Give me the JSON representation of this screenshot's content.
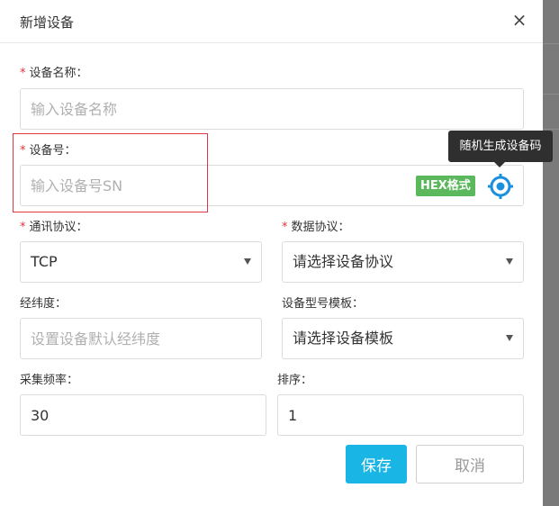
{
  "dialog": {
    "title": "新增设备",
    "close_symbol": "×"
  },
  "fields": {
    "device_name": {
      "required_mark": "*",
      "label": "设备名称：",
      "placeholder": "输入设备名称"
    },
    "device_sn": {
      "required_mark": "*",
      "label": "设备号：",
      "placeholder": "输入设备号SN",
      "badge": "HEX格式",
      "tooltip": "随机生成设备码",
      "icon": "locate-target-icon"
    },
    "comm_protocol": {
      "required_mark": "*",
      "label": "通讯协议：",
      "value": "TCP"
    },
    "data_protocol": {
      "required_mark": "*",
      "label": "数据协议：",
      "value": "请选择设备协议"
    },
    "coords": {
      "label": "经纬度：",
      "placeholder": "设置设备默认经纬度"
    },
    "model_template": {
      "label": "设备型号模板：",
      "value": "请选择设备模板"
    },
    "frequency": {
      "label": "采集频率：",
      "value": "30"
    },
    "sort": {
      "label": "排序：",
      "value": "1"
    }
  },
  "buttons": {
    "save": "保存",
    "cancel": "取消"
  },
  "colors": {
    "primary": "#18b5e5",
    "required": "#e5323e",
    "hex_badge": "#5cb85c",
    "icon": "#1a8fdd",
    "highlight": "#e0363f"
  }
}
